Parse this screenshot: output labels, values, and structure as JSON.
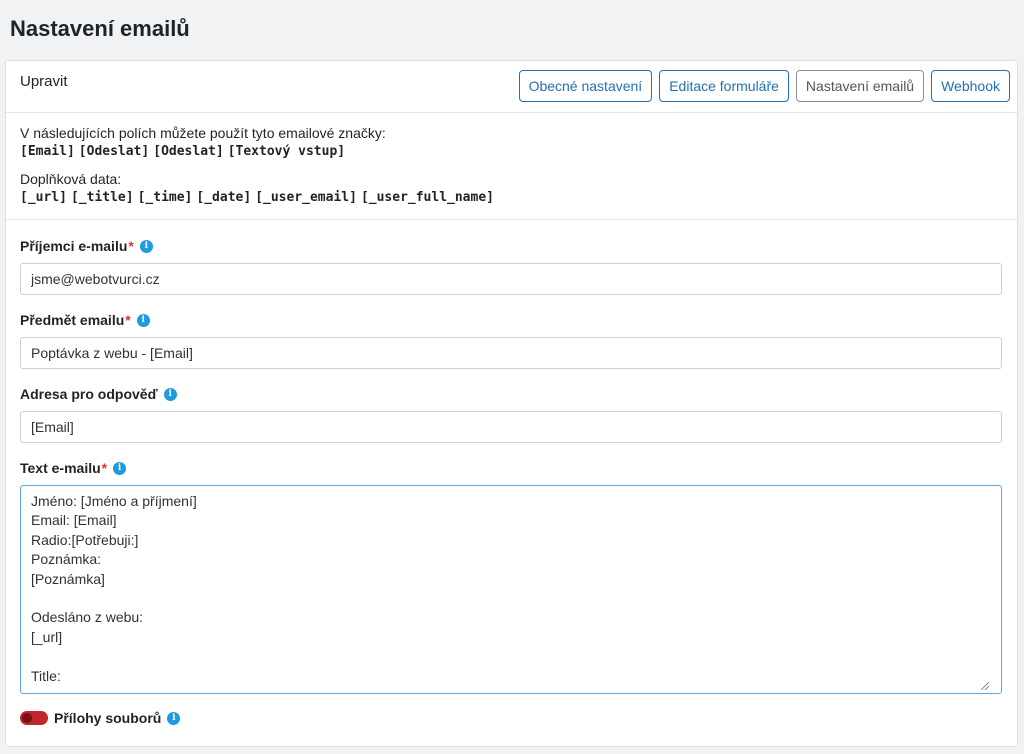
{
  "page": {
    "title": "Nastavení emailů"
  },
  "card": {
    "header_title": "Upravit",
    "tabs": [
      {
        "label": "Obecné nastavení",
        "active": false
      },
      {
        "label": "Editace formuláře",
        "active": false
      },
      {
        "label": "Nastavení emailů",
        "active": true
      },
      {
        "label": "Webhook",
        "active": false
      }
    ]
  },
  "info": {
    "intro": "V následujících polích můžete použít tyto emailové značky:",
    "tags": [
      "[Email]",
      "[Odeslat]",
      "[Odeslat]",
      "[Textový vstup]"
    ],
    "extra_label": "Doplňková data:",
    "extra_tags": [
      "[_url]",
      "[_title]",
      "[_time]",
      "[_date]",
      "[_user_email]",
      "[_user_full_name]"
    ]
  },
  "form": {
    "recipients": {
      "label": "Příjemci e-mailu",
      "required": "*",
      "value": "jsme@webotvurci.cz"
    },
    "subject": {
      "label": "Předmět emailu",
      "required": "*",
      "value": "Poptávka z webu - [Email]"
    },
    "reply_to": {
      "label": "Adresa pro odpověď",
      "value": "[Email]"
    },
    "body": {
      "label": "Text e-mailu",
      "required": "*",
      "value": "Jméno: [Jméno a příjmení]\nEmail: [Email]\nRadio:[Potřebuji:]\nPoznámka:\n[Poznámka]\n\nOdesláno z webu:\n[_url]\n\nTitle:"
    },
    "attachments": {
      "label": "Přílohy souborů",
      "enabled": false
    }
  },
  "icons": {
    "info": "info-icon",
    "accent": "#2271b1",
    "required_color": "#d63638",
    "toggle_color": "#c0262d"
  }
}
